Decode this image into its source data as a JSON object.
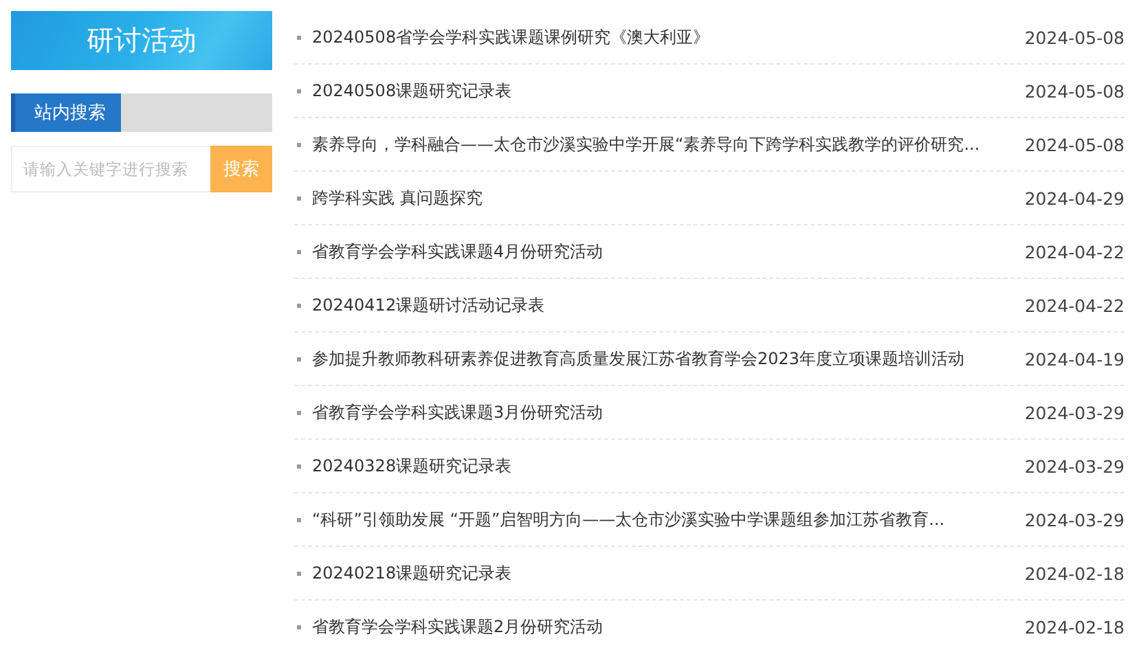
{
  "sidebar": {
    "title": "研讨活动",
    "search_heading": "站内搜索",
    "search": {
      "placeholder": "请输入关键字进行搜索",
      "button": "搜索"
    }
  },
  "articles": [
    {
      "title": "20240508省学会学科实践课题课例研究《澳大利亚》",
      "date": "2024-05-08"
    },
    {
      "title": "20240508课题研究记录表",
      "date": "2024-05-08"
    },
    {
      "title": "素养导向，学科融合——太仓市沙溪实验中学开展“素养导向下跨学科实践教学的评价研究...",
      "date": "2024-05-08"
    },
    {
      "title": "跨学科实践 真问题探究",
      "date": "2024-04-29"
    },
    {
      "title": "省教育学会学科实践课题4月份研究活动",
      "date": "2024-04-22"
    },
    {
      "title": "20240412课题研讨活动记录表",
      "date": "2024-04-22"
    },
    {
      "title": "参加提升教师教科研素养促进教育高质量发展江苏省教育学会2023年度立项课题培训活动",
      "date": "2024-04-19"
    },
    {
      "title": "省教育学会学科实践课题3月份研究活动",
      "date": "2024-03-29"
    },
    {
      "title": "20240328课题研究记录表",
      "date": "2024-03-29"
    },
    {
      "title": "“科研”引领助发展 “开题”启智明方向——太仓市沙溪实验中学课题组参加江苏省教育...",
      "date": "2024-03-29"
    },
    {
      "title": "20240218课题研究记录表",
      "date": "2024-02-18"
    },
    {
      "title": "省教育学会学科实践课题2月份研究活动",
      "date": "2024-02-18"
    }
  ]
}
